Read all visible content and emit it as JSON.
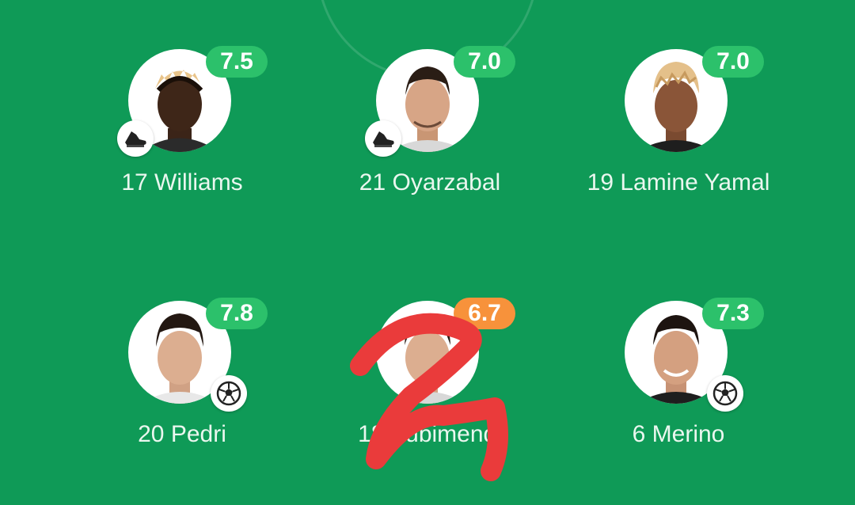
{
  "colors": {
    "pitch": "#0f9a57",
    "rating_green": "#2cc16b",
    "rating_orange": "#f7923b",
    "scribble_red": "#ea3b3b"
  },
  "players": [
    {
      "number": "17",
      "name": "Williams",
      "rating": "7.5",
      "rating_color": "#2cc16b",
      "event": "boot-icon"
    },
    {
      "number": "21",
      "name": "Oyarzabal",
      "rating": "7.0",
      "rating_color": "#2cc16b",
      "event": "boot-icon"
    },
    {
      "number": "19",
      "name": "Lamine Yamal",
      "rating": "7.0",
      "rating_color": "#2cc16b",
      "event": ""
    },
    {
      "number": "20",
      "name": "Pedri",
      "rating": "7.8",
      "rating_color": "#2cc16b",
      "event": "ball-icon"
    },
    {
      "number": "18",
      "name": "Zubimendi",
      "rating": "6.7",
      "rating_color": "#f7923b",
      "event": ""
    },
    {
      "number": "6",
      "name": "Merino",
      "rating": "7.3",
      "rating_color": "#2cc16b",
      "event": "ball-icon"
    }
  ]
}
